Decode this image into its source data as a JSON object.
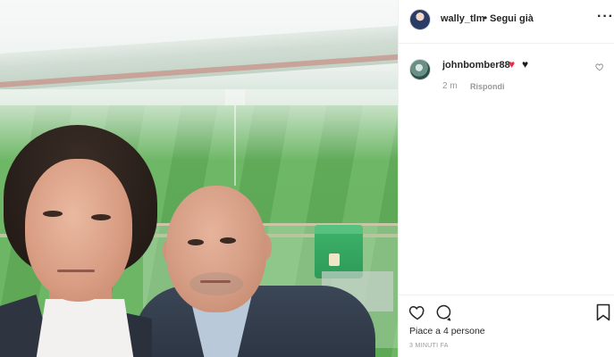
{
  "post": {
    "username": "wally_tlm",
    "separator": "•",
    "follow_label": "Segui già",
    "more_label": "···"
  },
  "comment": {
    "username": "johnbomber88",
    "hearts": [
      "♥",
      "♥"
    ],
    "time": "2 m",
    "reply_label": "Rispondi"
  },
  "footer": {
    "likes_text": "Piace a 4 persone",
    "time_ago": "3 MINUTI FA"
  },
  "icons": {
    "like": "heart-outline-icon",
    "comment": "speech-bubble-icon",
    "save": "bookmark-icon",
    "comment_like": "small-heart-icon"
  },
  "colors": {
    "heart_red": "#e0304a",
    "heart_black": "#1d1d1d",
    "text": "#262626",
    "muted": "#999999"
  }
}
